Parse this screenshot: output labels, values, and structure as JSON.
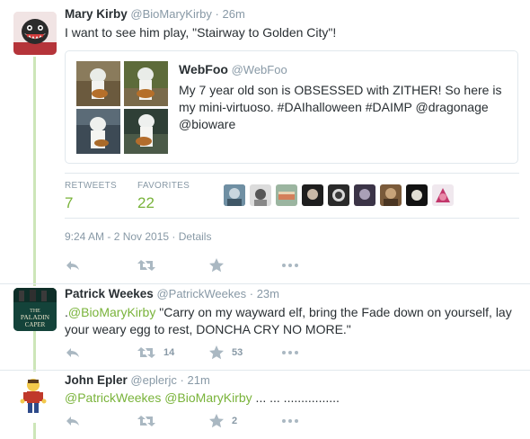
{
  "main_tweet": {
    "name": "Mary Kirby",
    "handle": "@BioMaryKirby",
    "time": "26m",
    "text": "I want to see him play, \"Stairway to Golden City\"!",
    "quoted": {
      "name": "WebFoo",
      "handle": "@WebFoo",
      "text": "My 7 year old son is OBSESSED with ZITHER! So here is my mini-virtuoso. #DAIhalloween #DAIMP @dragonage @bioware"
    },
    "stats": {
      "retweets_label": "RETWEETS",
      "retweets": "7",
      "favorites_label": "FAVORITES",
      "favorites": "22"
    },
    "timestamp": "9:24 AM - 2 Nov 2015",
    "separator": "·",
    "details_link": "Details"
  },
  "replies": [
    {
      "name": "Patrick Weekes",
      "handle": "@PatrickWeekes",
      "time": "23m",
      "prefix": ".",
      "mention": "@BioMaryKirby",
      "text_line1": " \"Carry on my wayward elf, bring the Fade down on yourself, lay",
      "text_line2": "your weary egg to rest, DONCHA CRY NO MORE.\"",
      "avatar_text": [
        "THE",
        "PALADIN",
        "CAPER"
      ],
      "retweet_count": "14",
      "favorite_count": "53"
    },
    {
      "name": "John Epler",
      "handle": "@eplerjc",
      "time": "21m",
      "mention1": "@PatrickWeekes",
      "mention2": "@BioMaryKirby",
      "text": " ... ... ................",
      "favorite_count": "2"
    }
  ],
  "colors": {
    "accent": "#79b33a",
    "muted": "#8899a6",
    "thread_line": "#cde6b8",
    "border": "#e1e8ed"
  },
  "icons": [
    "reply-icon",
    "retweet-icon",
    "favorite-icon",
    "more-icon"
  ]
}
